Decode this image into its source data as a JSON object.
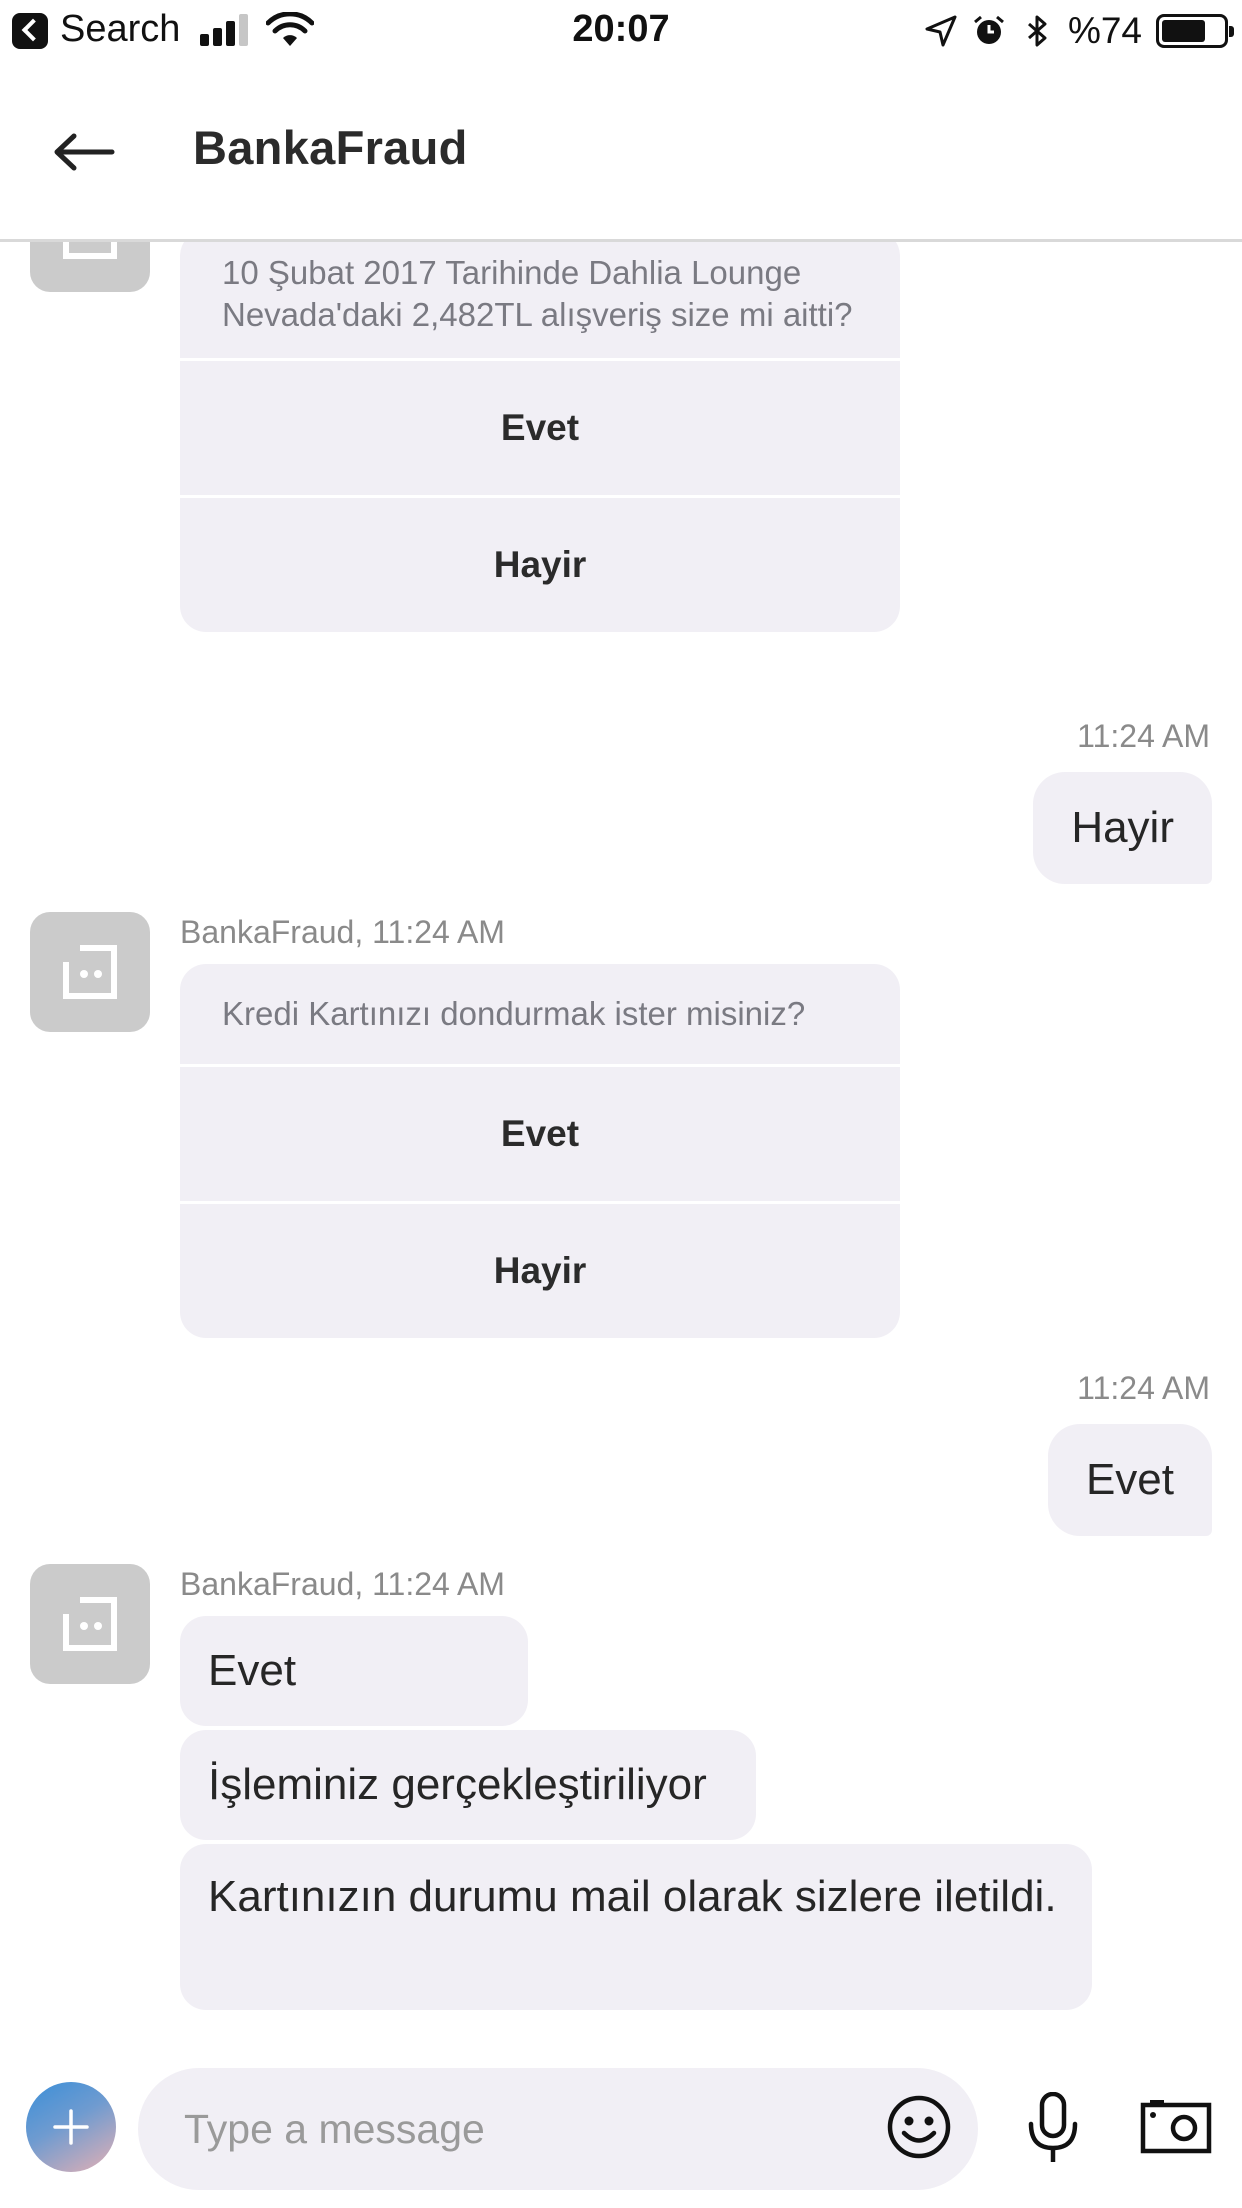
{
  "status_bar": {
    "back_app_label": "Search",
    "time": "20:07",
    "battery_percent_label": "%74",
    "battery_level": 0.74,
    "icons": [
      "back-app-icon",
      "signal-icon",
      "wifi-icon",
      "location-icon",
      "alarm-icon",
      "bluetooth-icon",
      "battery-icon"
    ]
  },
  "header": {
    "title": "BankaFraud",
    "back_icon": "arrow-left-icon"
  },
  "messages": {
    "card1": {
      "question": "10 Şubat 2017 Tarihinde Dahlia Lounge Nevada'daki 2,482TL alışveriş size mi aitti?",
      "option_yes": "Evet",
      "option_no": "Hayir"
    },
    "user_reply1": {
      "time": "11:24 AM",
      "text": "Hayir"
    },
    "bot2": {
      "sender": "BankaFraud, 11:24 AM",
      "question": "Kredi Kartınızı dondurmak ister misiniz?",
      "option_yes": "Evet",
      "option_no": "Hayir"
    },
    "user_reply2": {
      "time": "11:24 AM",
      "text": "Evet"
    },
    "bot3": {
      "sender": "BankaFraud, 11:24 AM",
      "bubbles": [
        "Evet",
        "İşleminiz gerçekleştiriliyor",
        "Kartınızın durumu mail olarak sizlere iletildi."
      ]
    }
  },
  "composer": {
    "placeholder": "Type a message",
    "add_icon": "plus-icon",
    "emoji_icon": "smiley-icon",
    "mic_icon": "microphone-icon",
    "camera_icon": "camera-icon"
  },
  "colors": {
    "bubble_bg": "#f1eff5",
    "avatar_bg": "#cbcbcb",
    "muted_text": "#8a8a8a",
    "accent_gradient_start": "#3b8fd8",
    "accent_gradient_end": "#e4b0b4"
  }
}
